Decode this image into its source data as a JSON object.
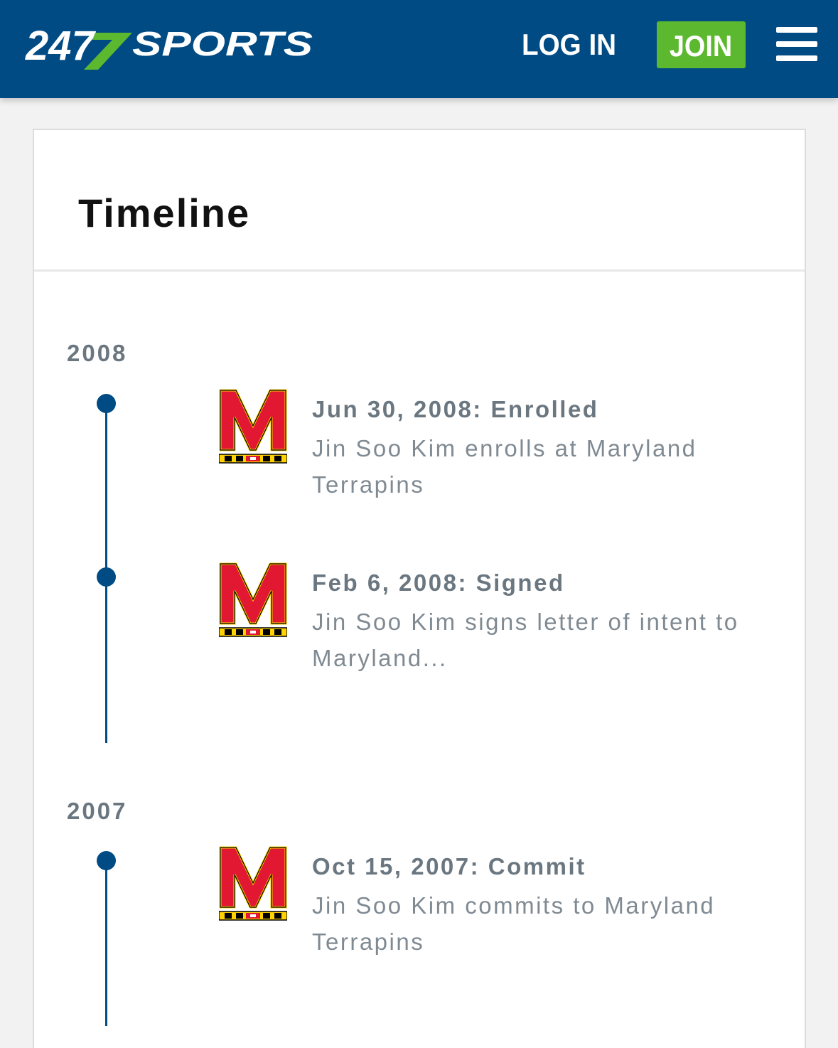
{
  "header": {
    "logo_text_number": "247",
    "logo_text_word": "SPORTS",
    "login_label": "LOG IN",
    "join_label": "JOIN",
    "menu_icon": "hamburger-icon",
    "colors": {
      "bar": "#004b84",
      "join": "#5cb82e",
      "logo_accent": "#5cb82e"
    }
  },
  "timeline": {
    "title": "Timeline",
    "groups": [
      {
        "year": "2008",
        "events": [
          {
            "heading": "Jun 30, 2008: Enrolled",
            "description": "Jin Soo Kim enrolls at Maryland Terrapins",
            "icon": "maryland-m-logo"
          },
          {
            "heading": "Feb 6, 2008: Signed",
            "description": "Jin Soo Kim signs letter of intent to Maryland...",
            "icon": "maryland-m-logo"
          }
        ]
      },
      {
        "year": "2007",
        "events": [
          {
            "heading": "Oct 15, 2007: Commit",
            "description": "Jin Soo Kim commits to Maryland Terrapins",
            "icon": "maryland-m-logo"
          }
        ]
      }
    ],
    "colors": {
      "line": "#004b84",
      "year_text": "#6b7780",
      "desc_text": "#808a92"
    }
  }
}
